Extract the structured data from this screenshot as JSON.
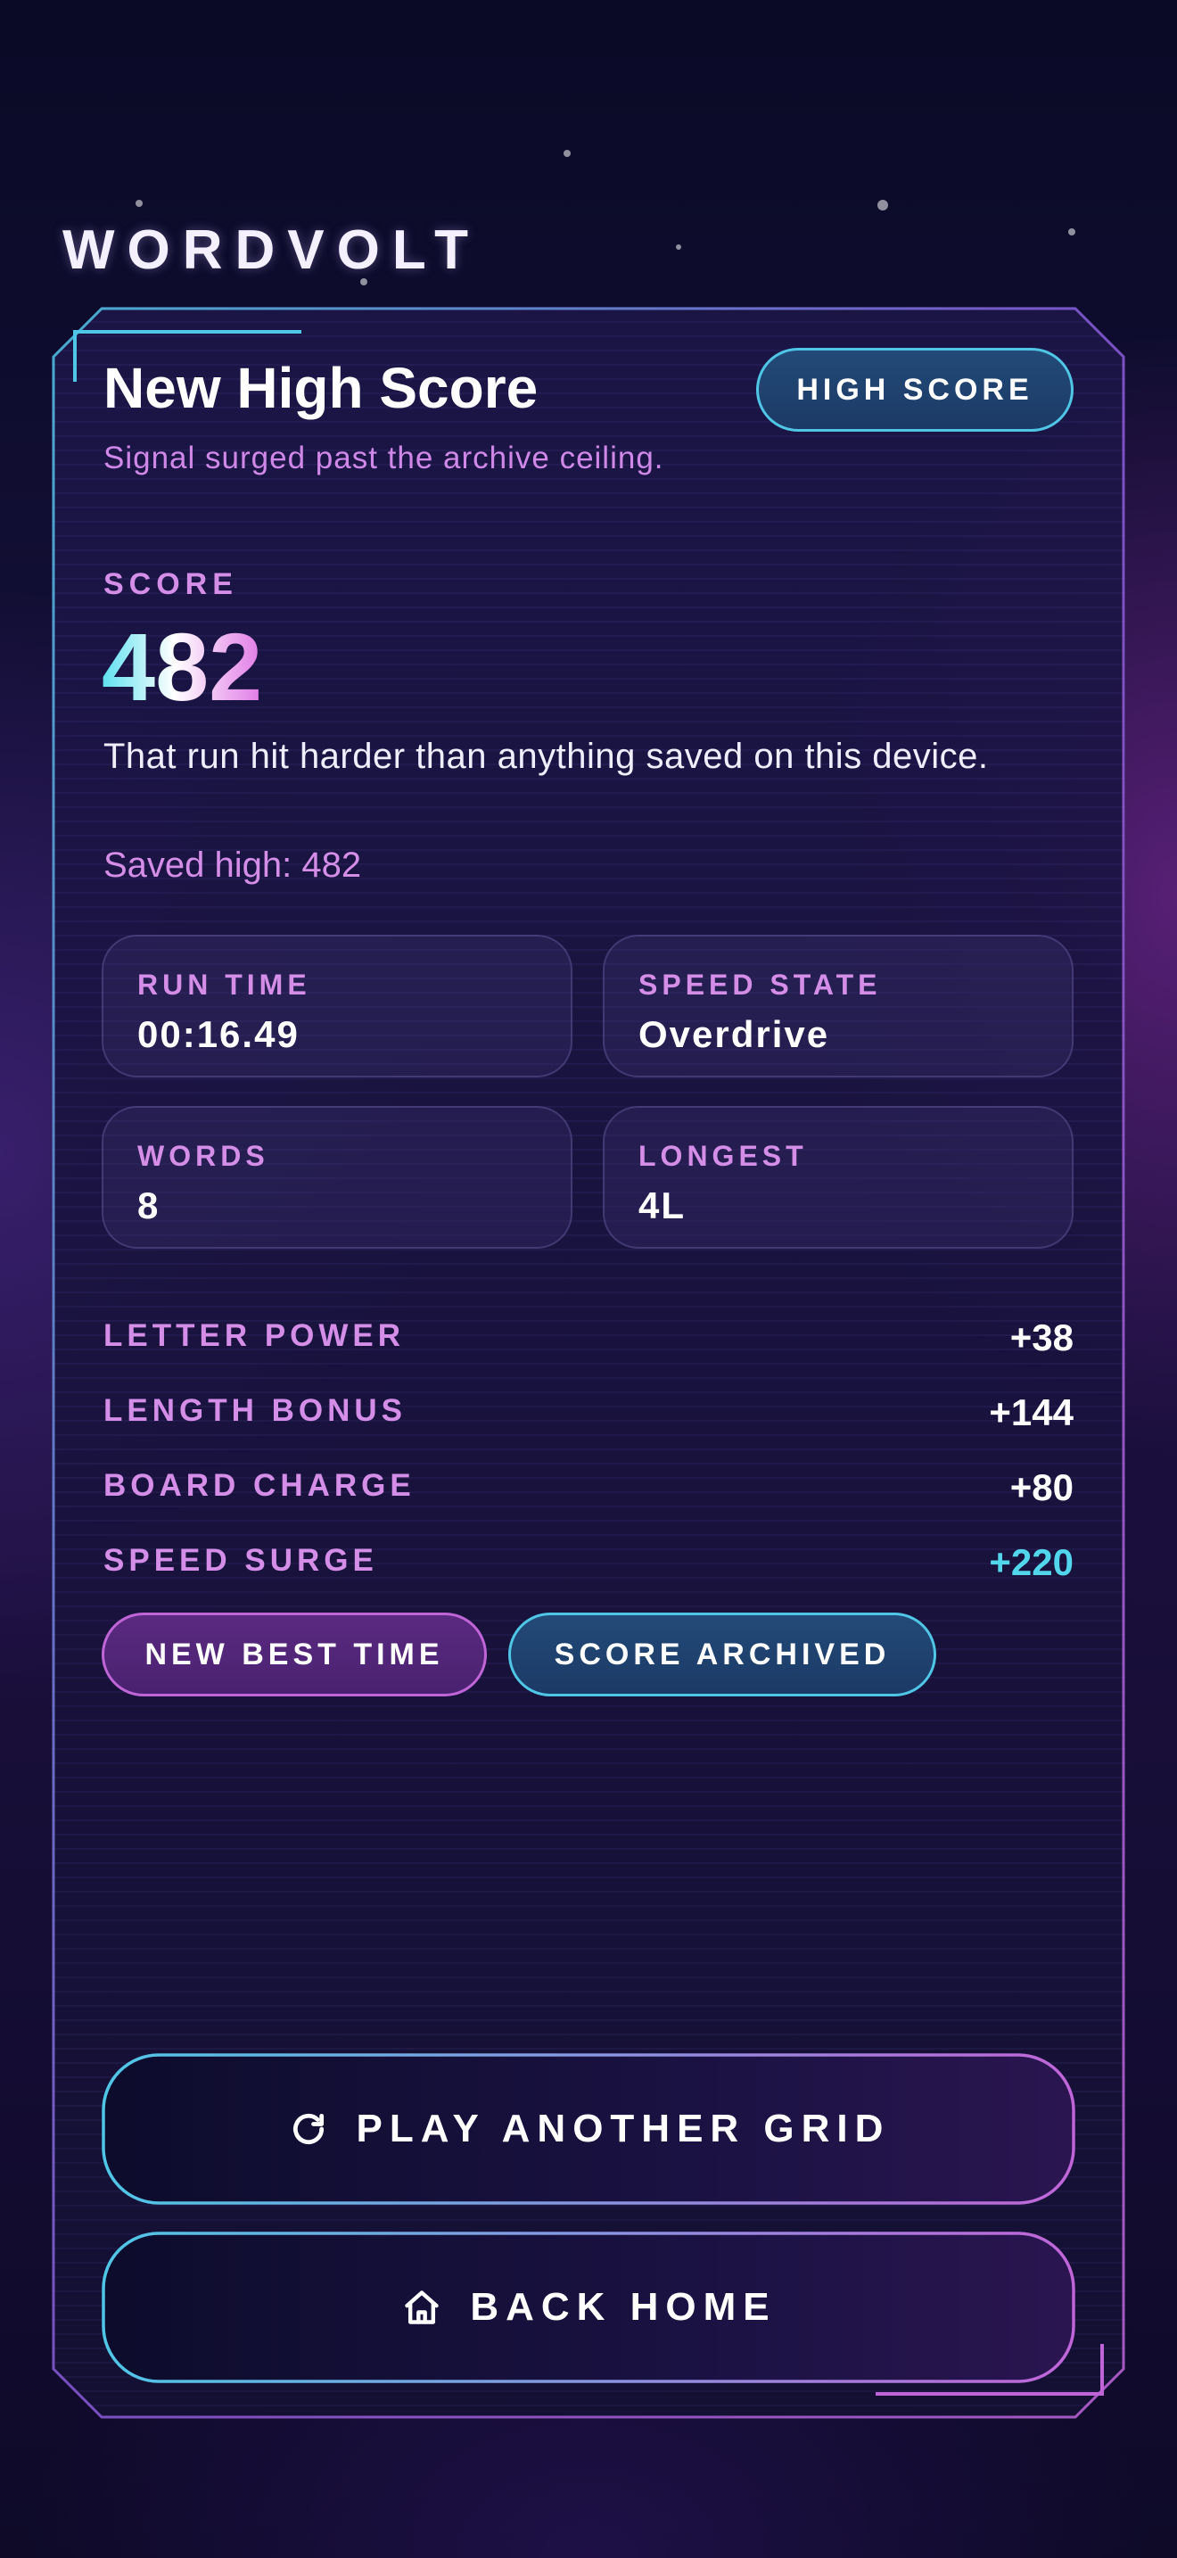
{
  "app": {
    "logo": "WORDVOLT"
  },
  "header": {
    "title": "New High Score",
    "subtitle": "Signal surged past the archive ceiling.",
    "badge": "HIGH SCORE"
  },
  "score": {
    "label": "SCORE",
    "value": "482",
    "message": "That run hit harder than anything saved on this device.",
    "saved_high": "Saved high: 482"
  },
  "stats": [
    {
      "label": "RUN TIME",
      "value": "00:16.49"
    },
    {
      "label": "SPEED STATE",
      "value": "Overdrive"
    },
    {
      "label": "WORDS",
      "value": "8"
    },
    {
      "label": "LONGEST",
      "value": "4L"
    }
  ],
  "breakdown": [
    {
      "label": "LETTER POWER",
      "value": "+38"
    },
    {
      "label": "LENGTH BONUS",
      "value": "+144"
    },
    {
      "label": "BOARD CHARGE",
      "value": "+80"
    },
    {
      "label": "SPEED SURGE",
      "value": "+220"
    }
  ],
  "badges": [
    {
      "label": "NEW BEST TIME"
    },
    {
      "label": "SCORE ARCHIVED"
    }
  ],
  "actions": {
    "play_again": "PLAY ANOTHER GRID",
    "play_again_icon": "refresh-icon",
    "back_home": "BACK HOME",
    "back_home_icon": "home-icon"
  },
  "colors": {
    "accent_cyan": "#4fc6e6",
    "accent_magenta": "#c065d8",
    "label_pink": "#d58ee8",
    "background": "#0b0a24"
  }
}
